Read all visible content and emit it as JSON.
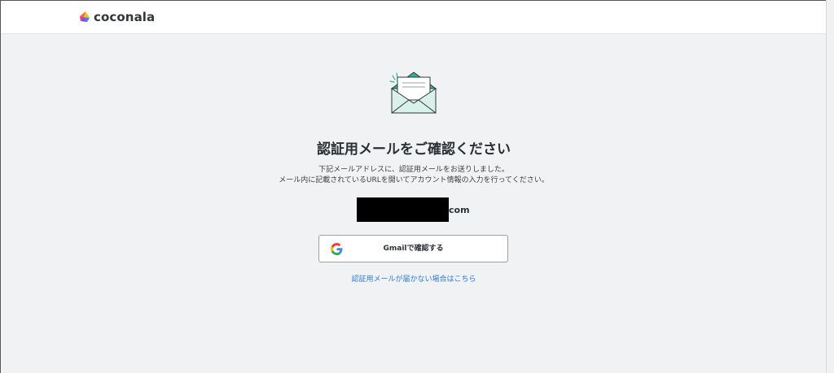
{
  "header": {
    "logo_text": "coconala"
  },
  "main": {
    "title": "認証用メールをご確認ください",
    "description_line1": "下記メールアドレスに、認証用メールをお送りしました。",
    "description_line2": "メール内に記載されているURLを開いてアカウント情報の入力を行ってください。",
    "email_suffix": "com",
    "gmail_button_label": "Gmailで確認する",
    "help_link": "認証用メールが届かない場合はこちら"
  },
  "colors": {
    "background": "#f1f2f3",
    "link": "#2d7ad6",
    "envelope_teal": "#2fb39a",
    "envelope_light": "#d9f1ea"
  }
}
